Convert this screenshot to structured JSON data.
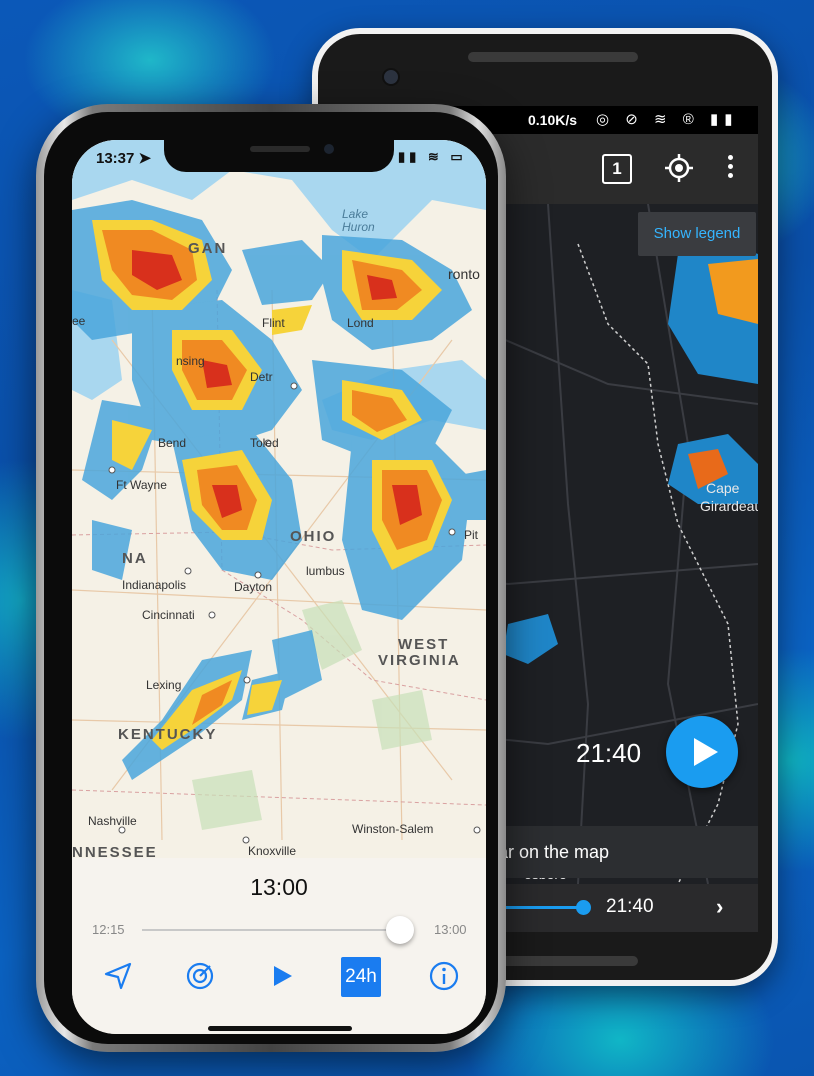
{
  "android": {
    "status": {
      "speed": "0.10K/s",
      "icons": "◎ ⊘ ≋ ® ▮▮"
    },
    "toolbar": {
      "layer_label": "1"
    },
    "legend_button": "Show legend",
    "cities": {
      "cape": "Cape",
      "girardeau": "Girardeau",
      "esboro": "esboro"
    },
    "time": "21:40",
    "snackbar": "ar on the map",
    "timeline": {
      "label": "21:40",
      "next": "›"
    }
  },
  "iphone": {
    "status": {
      "time": "13:37 ➤",
      "icons": "▮▮ ≋ ▭"
    },
    "map": {
      "labels": {
        "lake_huron": "Lake\nHuron",
        "gan": "GAN",
        "flint": "Flint",
        "ronto": "ronto",
        "lond": "Lond",
        "ee": "ee",
        "nsing": "nsing",
        "detr": "Detr",
        "bend": "Bend",
        "toledo": "Toled",
        "ft_wayne": "Ft Wayne",
        "ohio": "OHIO",
        "pitt": "Pit",
        "na": "NA",
        "lumbus": "lumbus",
        "indianapolis": "Indianapolis",
        "dayton": "Dayton",
        "cincinnati": "Cincinnati",
        "west": "WEST",
        "virginia": "VIRGINIA",
        "lexington": "Lexing",
        "kentucky": "KENTUCKY",
        "nashville": "Nashville",
        "winston": "Winston-Salem",
        "knoxville": "Knoxville",
        "nnessee": "NNESSEE"
      }
    },
    "player": {
      "current_time": "13:00",
      "start": "12:15",
      "end": "13:00",
      "progress": 1.0
    },
    "toolbar": {
      "range_label": "24h"
    }
  },
  "colors": {
    "accent_blue": "#1a7cf0",
    "android_blue": "#1a9cf0"
  }
}
